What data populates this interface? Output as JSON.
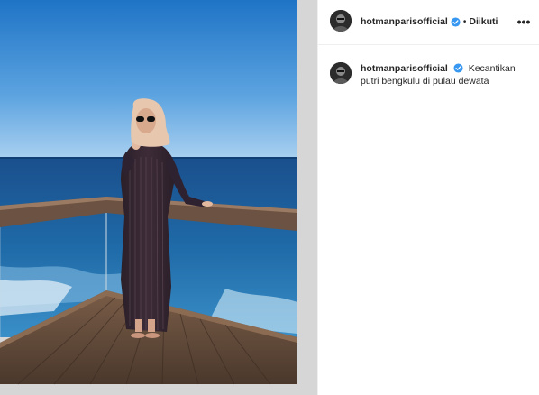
{
  "post": {
    "username": "hotmanparisofficial",
    "verified_icon": "verified-badge-icon",
    "separator": "•",
    "follow_label": "Diikuti",
    "more_icon_label": "•••",
    "caption_username": "hotmanparisofficial",
    "caption_text": "Kecantikan putri bengkulu di pulau dewata"
  },
  "colors": {
    "accent_verified": "#3897f0",
    "text": "#262626",
    "border": "#efefef"
  }
}
